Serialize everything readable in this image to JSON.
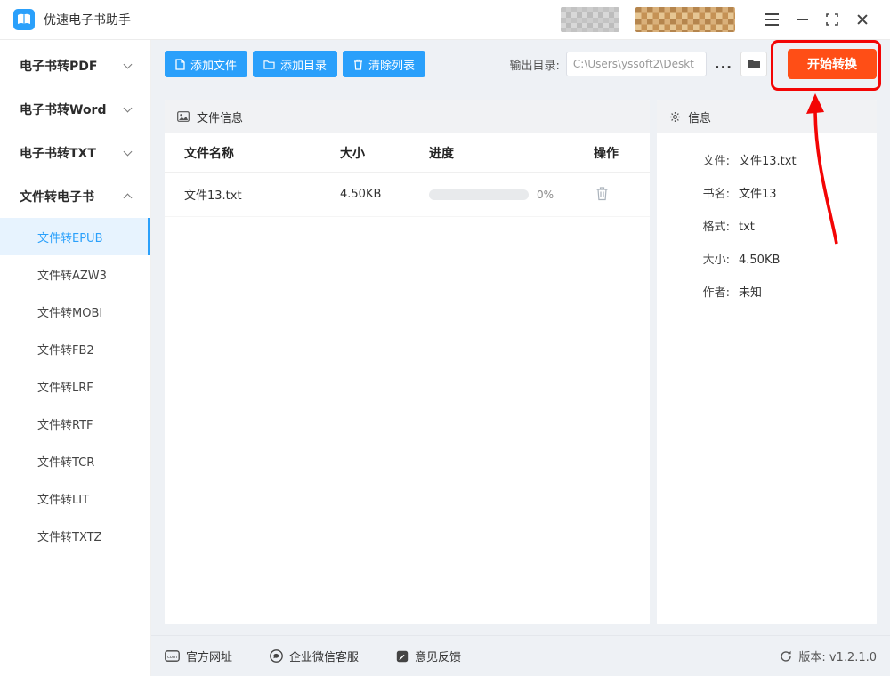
{
  "window": {
    "title": "优速电子书助手"
  },
  "sidebar": {
    "groups": [
      {
        "label": "电子书转PDF",
        "expanded": false
      },
      {
        "label": "电子书转Word",
        "expanded": false
      },
      {
        "label": "电子书转TXT",
        "expanded": false
      },
      {
        "label": "文件转电子书",
        "expanded": true
      }
    ],
    "subitems": [
      {
        "label": "文件转EPUB",
        "active": true
      },
      {
        "label": "文件转AZW3",
        "active": false
      },
      {
        "label": "文件转MOBI",
        "active": false
      },
      {
        "label": "文件转FB2",
        "active": false
      },
      {
        "label": "文件转LRF",
        "active": false
      },
      {
        "label": "文件转RTF",
        "active": false
      },
      {
        "label": "文件转TCR",
        "active": false
      },
      {
        "label": "文件转LIT",
        "active": false
      },
      {
        "label": "文件转TXTZ",
        "active": false
      }
    ]
  },
  "toolbar": {
    "add_file": "添加文件",
    "add_folder": "添加目录",
    "clear_list": "清除列表",
    "output_label": "输出目录:",
    "output_path": "C:\\Users\\yssoft2\\Deskt",
    "more_button": "...",
    "convert_button": "开始转换"
  },
  "file_panel": {
    "title": "文件信息",
    "columns": [
      "文件名称",
      "大小",
      "进度",
      "操作"
    ],
    "rows": [
      {
        "name": "文件13.txt",
        "size": "4.50KB",
        "progress_percent": 0,
        "progress_text": "0%"
      }
    ]
  },
  "info_panel": {
    "title": "信息",
    "fields": [
      {
        "label": "文件:",
        "value": "文件13.txt"
      },
      {
        "label": "书名:",
        "value": "文件13"
      },
      {
        "label": "格式:",
        "value": "txt"
      },
      {
        "label": "大小:",
        "value": "4.50KB"
      },
      {
        "label": "作者:",
        "value": "未知"
      }
    ]
  },
  "footer": {
    "links": [
      {
        "label": "官方网址"
      },
      {
        "label": "企业微信客服"
      },
      {
        "label": "意见反馈"
      }
    ],
    "version_label": "版本: v1.2.1.0"
  },
  "icons": {
    "app": "book-icon",
    "add_file": "file-icon",
    "add_folder": "folder-icon",
    "clear_list": "trash-icon",
    "file_panel": "image-card-icon",
    "info_panel": "gear-icon",
    "row_action": "trash-icon",
    "official_site": "com-badge-icon",
    "wechat_service": "chat-circle-icon",
    "feedback": "feedback-icon",
    "version": "refresh-icon"
  },
  "colors": {
    "accent_blue": "#2aa0fb",
    "accent_orange": "#ff4e16",
    "annotation_red": "#f30505",
    "sidebar_active_bg": "#e7f3fe",
    "page_bg": "#eef1f5"
  }
}
